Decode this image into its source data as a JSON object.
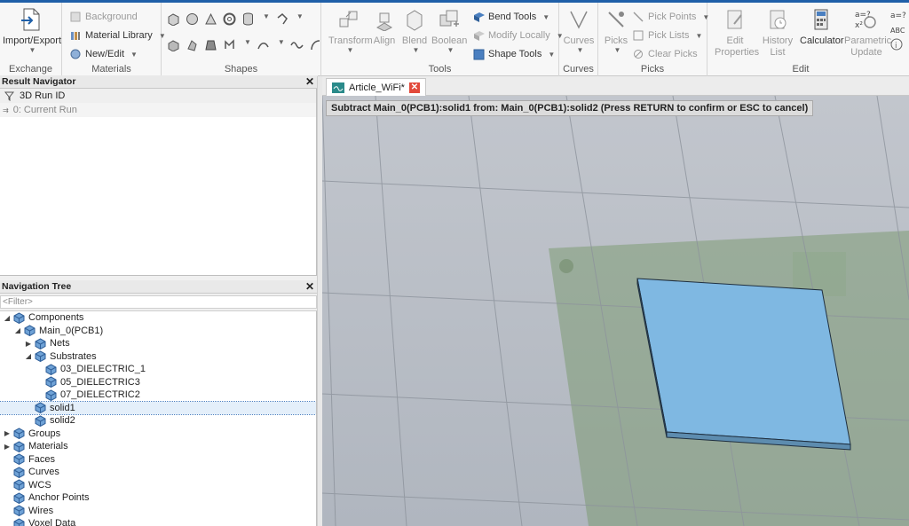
{
  "ribbon": {
    "groups": {
      "exchange": "Exchange",
      "materials": "Materials",
      "shapes": "Shapes",
      "tools": "Tools",
      "curves": "Curves",
      "picks": "Picks",
      "edit": "Edit"
    },
    "import_export": "Import/Export",
    "background": "Background",
    "material_library": "Material Library",
    "new_edit": "New/Edit",
    "transform": "Transform",
    "align": "Align",
    "blend": "Blend",
    "boolean": "Boolean",
    "bend_tools": "Bend Tools",
    "modify_locally": "Modify Locally",
    "shape_tools": "Shape Tools",
    "curves_btn": "Curves",
    "picks_btn": "Picks",
    "pick_points": "Pick Points",
    "pick_lists": "Pick Lists",
    "clear_picks": "Clear Picks",
    "edit_properties": "Edit Properties",
    "history_list": "History List",
    "calculator": "Calculator",
    "parametric_update": "Parametric Update"
  },
  "result_navigator": {
    "title": "Result Navigator",
    "column": "3D Run ID",
    "row": "0: Current Run"
  },
  "navigation_tree": {
    "title": "Navigation Tree",
    "filter_placeholder": "<Filter>",
    "items": [
      {
        "label": "Components",
        "level": 0,
        "toggle": "expanded"
      },
      {
        "label": "Main_0(PCB1)",
        "level": 1,
        "toggle": "expanded"
      },
      {
        "label": "Nets",
        "level": 2,
        "toggle": "collapsed"
      },
      {
        "label": "Substrates",
        "level": 2,
        "toggle": "expanded"
      },
      {
        "label": "03_DIELECTRIC_1",
        "level": 3,
        "toggle": "none"
      },
      {
        "label": "05_DIELECTRIC3",
        "level": 3,
        "toggle": "none"
      },
      {
        "label": "07_DIELECTRIC2",
        "level": 3,
        "toggle": "none"
      },
      {
        "label": "solid1",
        "level": 2,
        "toggle": "none",
        "selected": true
      },
      {
        "label": "solid2",
        "level": 2,
        "toggle": "none"
      },
      {
        "label": "Groups",
        "level": 0,
        "toggle": "collapsed"
      },
      {
        "label": "Materials",
        "level": 0,
        "toggle": "collapsed"
      },
      {
        "label": "Faces",
        "level": 0,
        "toggle": "none"
      },
      {
        "label": "Curves",
        "level": 0,
        "toggle": "none"
      },
      {
        "label": "WCS",
        "level": 0,
        "toggle": "none"
      },
      {
        "label": "Anchor Points",
        "level": 0,
        "toggle": "none"
      },
      {
        "label": "Wires",
        "level": 0,
        "toggle": "none"
      },
      {
        "label": "Voxel Data",
        "level": 0,
        "toggle": "none"
      }
    ]
  },
  "document_tab": {
    "label": "Article_WiFi*"
  },
  "viewport": {
    "hint": "Subtract Main_0(PCB1):solid1 from: Main_0(PCB1):solid2  (Press RETURN to confirm or ESC to cancel)"
  },
  "colors": {
    "accent": "#1f5fa8",
    "solid_block": "#7fb8e2",
    "pcb_board": "#7d9a74",
    "tab_close": "#e2493b"
  }
}
